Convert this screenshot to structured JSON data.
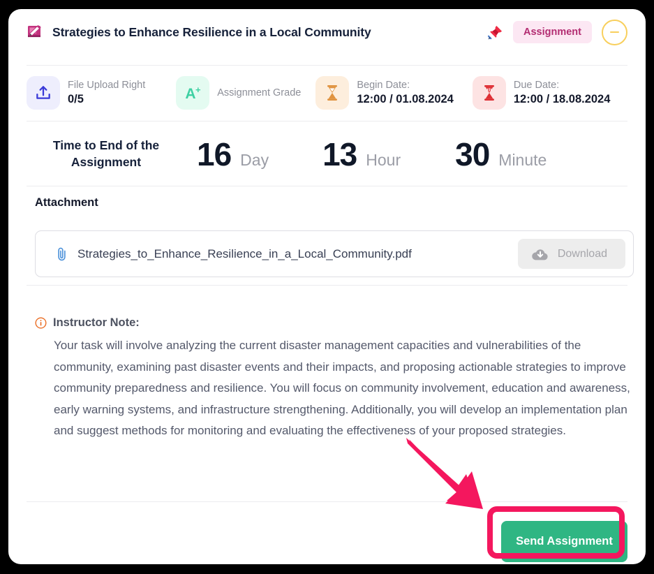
{
  "header": {
    "icon": "notebook-pencil-icon",
    "title": "Strategies to Enhance Resilience in a Local Community",
    "pin_icon": "pushpin-icon",
    "badge_label": "Assignment",
    "collapse_icon": "minus-circle-icon"
  },
  "stats": [
    {
      "icon": "upload-icon",
      "label": "File Upload Right",
      "value": "0/5",
      "tile_bg": "#eeeefd",
      "icon_color": "#3a3ad8"
    },
    {
      "icon": "grade-a-plus-icon",
      "label": "Assignment Grade",
      "value": "",
      "tile_bg": "#e4fbf1",
      "icon_color": "#3ed0a3"
    },
    {
      "icon": "hourglass-icon",
      "label": "Begin Date:",
      "value": "12:00 / 01.08.2024",
      "tile_bg": "#fdeedd",
      "icon_color": "#e09340"
    },
    {
      "icon": "hourglass-icon",
      "label": "Due Date:",
      "value": "12:00 / 18.08.2024",
      "tile_bg": "#fde3e3",
      "icon_color": "#de2f35"
    }
  ],
  "countdown": {
    "caption": "Time to End of the Assignment",
    "units": [
      {
        "value": "16",
        "label": "Day"
      },
      {
        "value": "13",
        "label": "Hour"
      },
      {
        "value": "30",
        "label": "Minute"
      }
    ]
  },
  "attachment": {
    "heading": "Attachment",
    "clip_icon": "paperclip-icon",
    "filename": "Strategies_to_Enhance_Resilience_in_a_Local_Community.pdf",
    "download": {
      "icon": "cloud-download-icon",
      "label": "Download",
      "disabled": true
    }
  },
  "note": {
    "icon": "info-circle-icon",
    "title": "Instructor Note:",
    "body": "Your task will involve analyzing the current disaster management capacities and vulnerabilities of the community, examining past disaster events and their impacts, and proposing actionable strategies to improve community preparedness and resilience. You will focus on community involvement, education and awareness, early warning systems, and infrastructure strengthening. Additionally, you will develop an implementation plan and suggest methods for monitoring and evaluating the effectiveness of your proposed strategies."
  },
  "footer": {
    "send_label": "Send Assignment",
    "send_bg": "#2fb683",
    "highlight_color": "#f4175e",
    "arrow_icon": "annotation-arrow-icon"
  },
  "colors": {
    "page_bg": "#000000",
    "card_bg": "#ffffff",
    "badge_bg": "#fce7f3",
    "badge_fg": "#b32d72",
    "collapse_outline": "#f8cf5c",
    "divider": "#ececef"
  }
}
